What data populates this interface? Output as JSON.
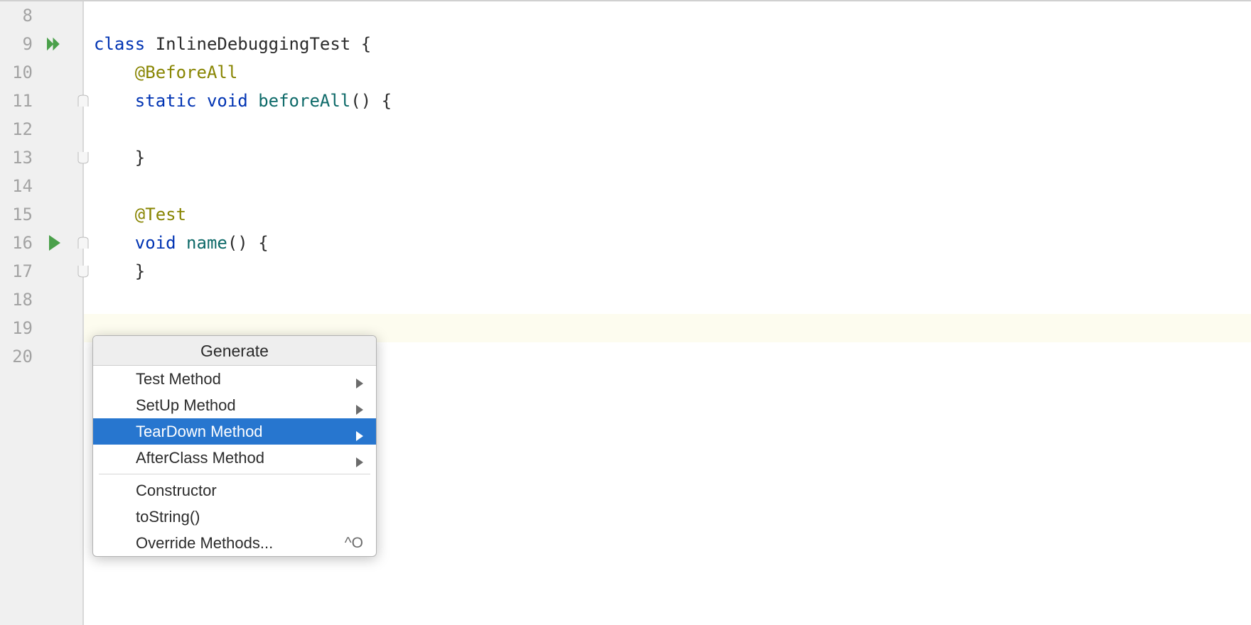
{
  "lines": {
    "8": "8",
    "9": "9",
    "10": "10",
    "11": "11",
    "12": "12",
    "13": "13",
    "14": "14",
    "15": "15",
    "16": "16",
    "17": "17",
    "18": "18",
    "19": "19",
    "20": "20"
  },
  "code": {
    "class_kw": "class",
    "class_name": " InlineDebuggingTest ",
    "open_brace": "{",
    "close_brace": "}",
    "before_annot": "@BeforeAll",
    "static_kw": "static",
    "void_kw": "void",
    "before_method": "beforeAll",
    "parens_brace": "() {",
    "close_brace2": "}",
    "test_annot": "@Test",
    "name_method": "name",
    "parens_brace2": "() {",
    "close_brace3": "}",
    "indent1": "    ",
    "indent2": "        ",
    "space": " "
  },
  "popup": {
    "title": "Generate",
    "items": [
      {
        "label": "Test Method",
        "submenu": true,
        "selected": false
      },
      {
        "label": "SetUp Method",
        "submenu": true,
        "selected": false
      },
      {
        "label": "TearDown Method",
        "submenu": true,
        "selected": true
      },
      {
        "label": "AfterClass Method",
        "submenu": true,
        "selected": false
      }
    ],
    "items2": [
      {
        "label": "Constructor",
        "submenu": false
      },
      {
        "label": "toString()",
        "submenu": false
      },
      {
        "label": "Override Methods...",
        "submenu": false,
        "shortcut": "^O"
      }
    ]
  },
  "icons": {
    "run_all": "run-all-icon",
    "run": "run-icon",
    "fold_start": "fold-start-icon",
    "fold_end": "fold-end-icon",
    "chevron": "chevron-right-icon"
  }
}
